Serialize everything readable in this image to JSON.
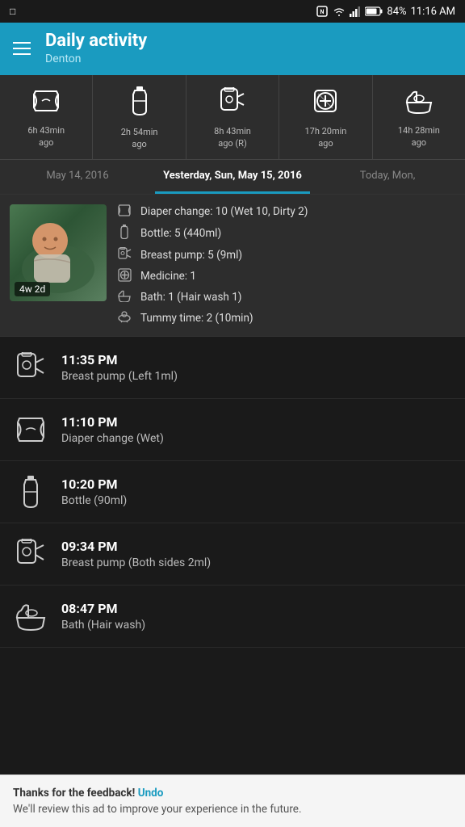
{
  "statusBar": {
    "leftIcon": "□",
    "battery": "84%",
    "time": "11:16 AM"
  },
  "header": {
    "title": "Daily activity",
    "subtitle": "Denton"
  },
  "quickStats": [
    {
      "icon": "diaper",
      "time": "6h 43min",
      "unit": "ago"
    },
    {
      "icon": "bottle",
      "time": "2h 54min",
      "unit": "ago"
    },
    {
      "icon": "pump",
      "time": "8h 43min",
      "unit": "ago (R)"
    },
    {
      "icon": "medicine",
      "time": "17h 20min",
      "unit": "ago"
    },
    {
      "icon": "bath",
      "time": "14h 28min",
      "unit": "ago"
    }
  ],
  "dateTabs": [
    {
      "label": "May 14, 2016",
      "active": false
    },
    {
      "label": "Yesterday, Sun, May 15, 2016",
      "active": true
    },
    {
      "label": "Today, Mon,",
      "active": false
    }
  ],
  "summary": {
    "babyAge": "4w 2d",
    "items": [
      {
        "text": "Diaper change: 10 (Wet 10, Dirty 2)"
      },
      {
        "text": "Bottle: 5 (440ml)"
      },
      {
        "text": "Breast pump: 5 (9ml)"
      },
      {
        "text": "Medicine: 1"
      },
      {
        "text": "Bath: 1 (Hair wash 1)"
      },
      {
        "text": "Tummy time: 2 (10min)"
      }
    ]
  },
  "activities": [
    {
      "time": "11:35 PM",
      "desc": "Breast pump (Left 1ml)",
      "icon": "pump"
    },
    {
      "time": "11:10 PM",
      "desc": "Diaper change (Wet)",
      "icon": "diaper"
    },
    {
      "time": "10:20 PM",
      "desc": "Bottle (90ml)",
      "icon": "bottle"
    },
    {
      "time": "09:34 PM",
      "desc": "Breast pump (Both sides 2ml)",
      "icon": "pump"
    },
    {
      "time": "08:47 PM",
      "desc": "Bath (Hair wash)",
      "icon": "bath"
    }
  ],
  "feedback": {
    "line1bold": "Thanks for the feedback!",
    "line1undo": "Undo",
    "line2": "We'll review this ad to improve your experience in the future."
  }
}
